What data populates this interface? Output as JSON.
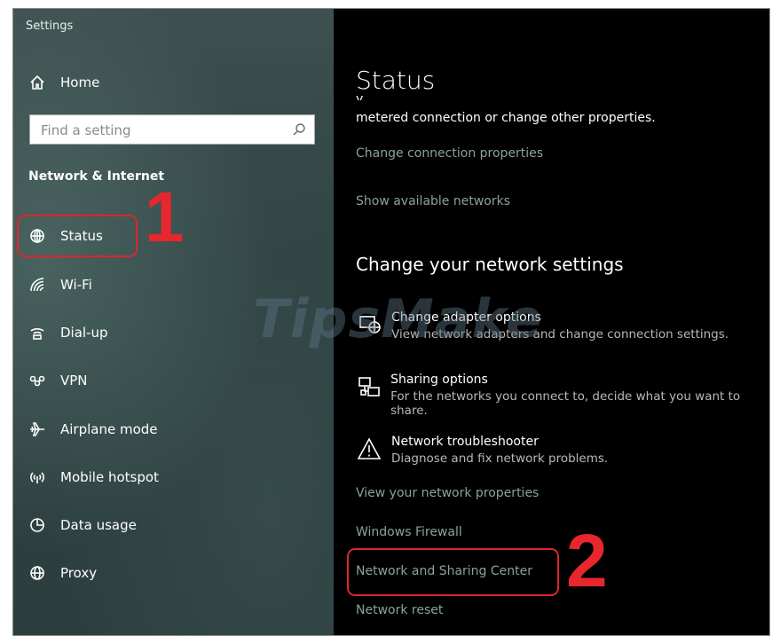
{
  "window": {
    "title": "Settings"
  },
  "sidebar": {
    "home_label": "Home",
    "search_placeholder": "Find a setting",
    "section_title": "Network & Internet",
    "items": [
      {
        "label": "Status",
        "icon": "globe-status-icon"
      },
      {
        "label": "Wi-Fi",
        "icon": "wifi-icon"
      },
      {
        "label": "Dial-up",
        "icon": "dialup-icon"
      },
      {
        "label": "VPN",
        "icon": "vpn-icon"
      },
      {
        "label": "Airplane mode",
        "icon": "airplane-icon"
      },
      {
        "label": "Mobile hotspot",
        "icon": "hotspot-icon"
      },
      {
        "label": "Data usage",
        "icon": "data-usage-icon"
      },
      {
        "label": "Proxy",
        "icon": "globe-icon"
      }
    ]
  },
  "main": {
    "title": "Status",
    "cut_text": "y                  ,  ,",
    "description": "metered connection or change other properties.",
    "links_top": [
      "Change connection properties",
      "Show available networks"
    ],
    "section_heading": "Change your network settings",
    "options": [
      {
        "title": "Change adapter options",
        "desc": "View network adapters and change connection settings.",
        "icon": "adapter-icon"
      },
      {
        "title": "Sharing options",
        "desc": "For the networks you connect to, decide what you want to share.",
        "icon": "sharing-icon"
      },
      {
        "title": "Network troubleshooter",
        "desc": "Diagnose and fix network problems.",
        "icon": "warning-icon"
      }
    ],
    "links_bottom": [
      "View your network properties",
      "Windows Firewall",
      "Network and Sharing Center",
      "Network reset"
    ]
  },
  "annotations": {
    "marker_1": "1",
    "marker_2": "2",
    "color": "#e8262e"
  },
  "watermark": "TipsMake"
}
